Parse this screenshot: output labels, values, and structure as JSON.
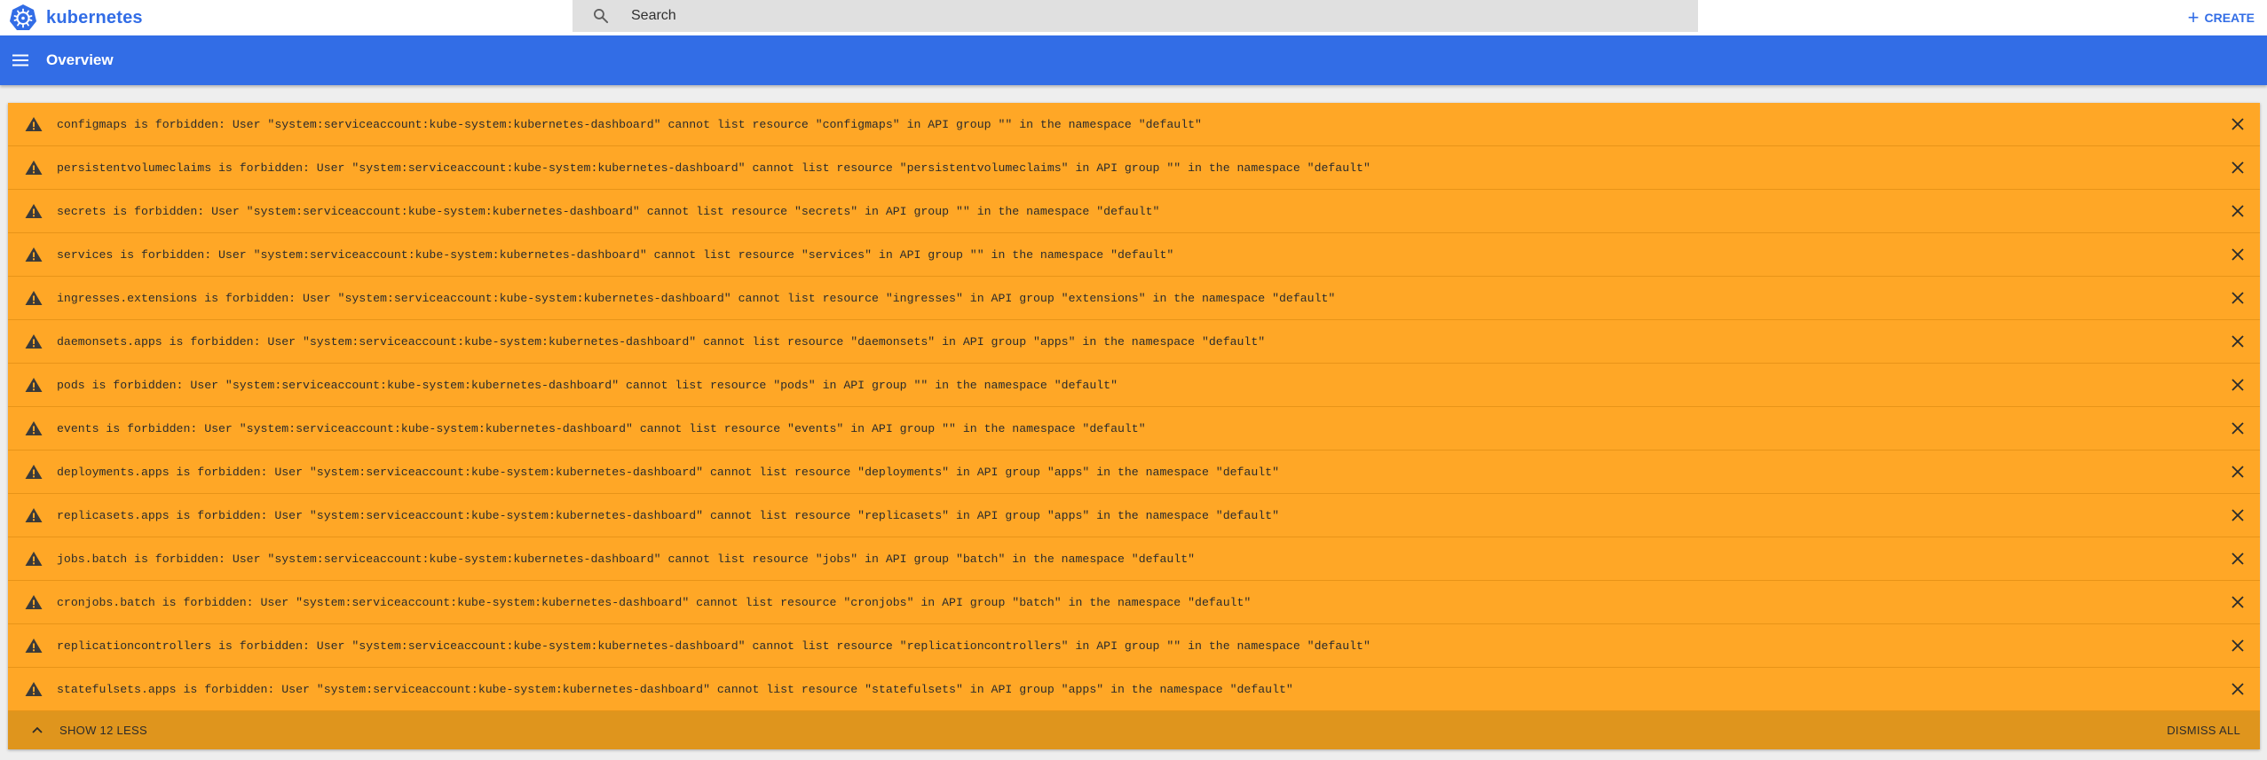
{
  "header": {
    "brand": "kubernetes",
    "brand_icon": "kubernetes-logo-icon",
    "search_placeholder": "Search",
    "search_value": "",
    "create_label": "CREATE",
    "accent_color": "#326de6"
  },
  "toolbar": {
    "title": "Overview",
    "menu_icon": "hamburger-menu-icon"
  },
  "notifications": {
    "color": "#ffa726",
    "items": [
      {
        "text": "configmaps is forbidden: User \"system:serviceaccount:kube-system:kubernetes-dashboard\" cannot list resource \"configmaps\" in API group \"\" in the namespace \"default\""
      },
      {
        "text": "persistentvolumeclaims is forbidden: User \"system:serviceaccount:kube-system:kubernetes-dashboard\" cannot list resource \"persistentvolumeclaims\" in API group \"\" in the namespace \"default\""
      },
      {
        "text": "secrets is forbidden: User \"system:serviceaccount:kube-system:kubernetes-dashboard\" cannot list resource \"secrets\" in API group \"\" in the namespace \"default\""
      },
      {
        "text": "services is forbidden: User \"system:serviceaccount:kube-system:kubernetes-dashboard\" cannot list resource \"services\" in API group \"\" in the namespace \"default\""
      },
      {
        "text": "ingresses.extensions is forbidden: User \"system:serviceaccount:kube-system:kubernetes-dashboard\" cannot list resource \"ingresses\" in API group \"extensions\" in the namespace \"default\""
      },
      {
        "text": "daemonsets.apps is forbidden: User \"system:serviceaccount:kube-system:kubernetes-dashboard\" cannot list resource \"daemonsets\" in API group \"apps\" in the namespace \"default\""
      },
      {
        "text": "pods is forbidden: User \"system:serviceaccount:kube-system:kubernetes-dashboard\" cannot list resource \"pods\" in API group \"\" in the namespace \"default\""
      },
      {
        "text": "events is forbidden: User \"system:serviceaccount:kube-system:kubernetes-dashboard\" cannot list resource \"events\" in API group \"\" in the namespace \"default\""
      },
      {
        "text": "deployments.apps is forbidden: User \"system:serviceaccount:kube-system:kubernetes-dashboard\" cannot list resource \"deployments\" in API group \"apps\" in the namespace \"default\""
      },
      {
        "text": "replicasets.apps is forbidden: User \"system:serviceaccount:kube-system:kubernetes-dashboard\" cannot list resource \"replicasets\" in API group \"apps\" in the namespace \"default\""
      },
      {
        "text": "jobs.batch is forbidden: User \"system:serviceaccount:kube-system:kubernetes-dashboard\" cannot list resource \"jobs\" in API group \"batch\" in the namespace \"default\""
      },
      {
        "text": "cronjobs.batch is forbidden: User \"system:serviceaccount:kube-system:kubernetes-dashboard\" cannot list resource \"cronjobs\" in API group \"batch\" in the namespace \"default\""
      },
      {
        "text": "replicationcontrollers is forbidden: User \"system:serviceaccount:kube-system:kubernetes-dashboard\" cannot list resource \"replicationcontrollers\" in API group \"\" in the namespace \"default\""
      },
      {
        "text": "statefulsets.apps is forbidden: User \"system:serviceaccount:kube-system:kubernetes-dashboard\" cannot list resource \"statefulsets\" in API group \"apps\" in the namespace \"default\""
      }
    ],
    "show_less_label": "SHOW 12 LESS",
    "dismiss_all_label": "DISMISS ALL"
  }
}
